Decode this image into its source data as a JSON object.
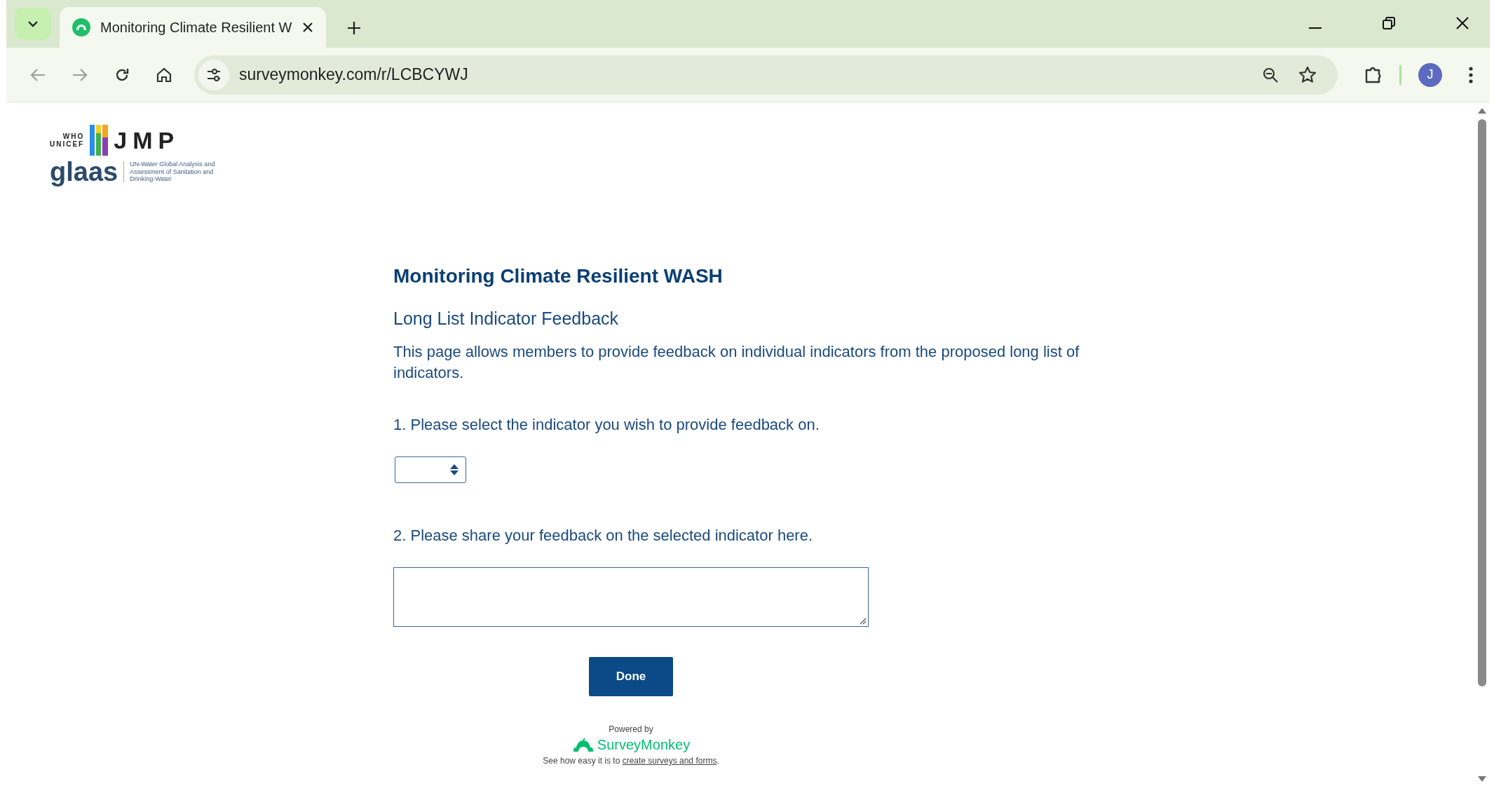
{
  "browser": {
    "tab": {
      "title": "Monitoring Climate Resilient W",
      "selected": true
    },
    "url": "surveymonkey.com/r/LCBCYWJ",
    "avatar": "J"
  },
  "logo": {
    "who": "WHO",
    "unicef": "UNICEF",
    "jmp": "JMP",
    "glaas": "glaas",
    "glaas_caption": "UN-Water Global Analysis and Assessment of Sanitation and Drinking-Water"
  },
  "survey": {
    "title": "Monitoring Climate Resilient WASH",
    "page_title": "Long List Indicator Feedback",
    "description": "This page allows members to provide feedback on individual indicators from the proposed long list of indicators.",
    "questions": [
      {
        "kind": "dropdown",
        "prompt": "1. Please select the indicator you wish to provide feedback on."
      },
      {
        "kind": "textarea",
        "prompt": "2. Please share your feedback on the selected indicator here."
      }
    ],
    "done_button": "Done"
  },
  "footer": {
    "powered_by": "Powered by",
    "brand": "SurveyMonkey",
    "tagline": "See how easy it is to ",
    "link": "create surveys and forms",
    "end": "."
  }
}
